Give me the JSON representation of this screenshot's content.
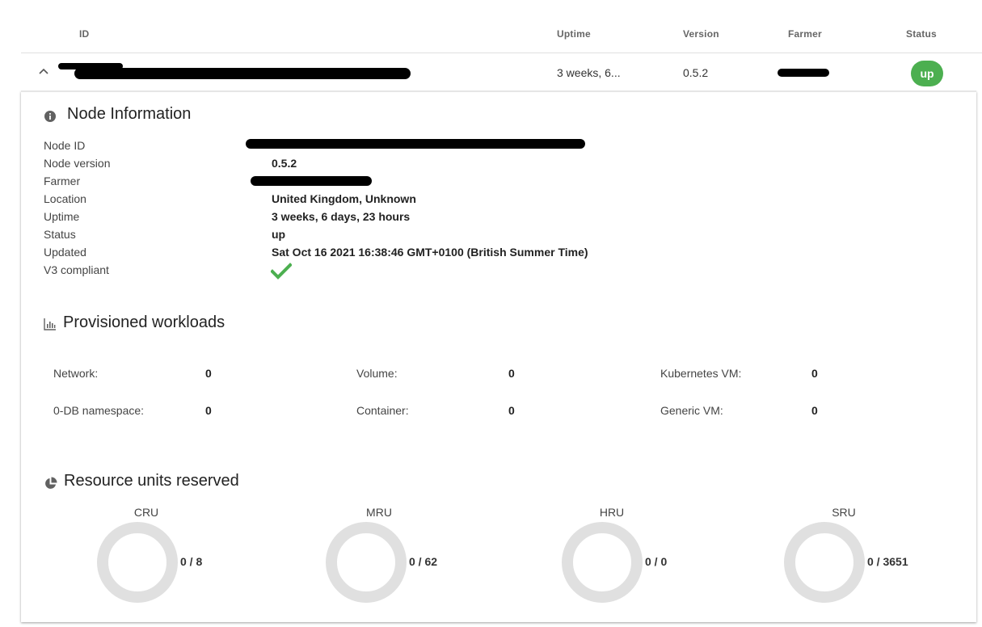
{
  "table": {
    "headers": {
      "id": "ID",
      "uptime": "Uptime",
      "version": "Version",
      "farmer": "Farmer",
      "status": "Status"
    },
    "row": {
      "uptime": "3 weeks, 6...",
      "version": "0.5.2",
      "status": "up"
    }
  },
  "node_info": {
    "title": "Node Information",
    "labels": [
      "Node ID",
      "Node version",
      "Farmer",
      "Location",
      "Uptime",
      "Status",
      "Updated",
      "V3 compliant"
    ],
    "values": {
      "node_version": "0.5.2",
      "location": "United Kingdom, Unknown",
      "uptime": "3 weeks, 6 days, 23 hours",
      "status": "up",
      "updated": "Sat Oct 16 2021 16:38:46 GMT+0100 (British Summer Time)",
      "v3_compliant_icon": "check-icon"
    }
  },
  "workloads": {
    "title": "Provisioned workloads",
    "items": [
      {
        "label": "Network:",
        "value": "0"
      },
      {
        "label": "Volume:",
        "value": "0"
      },
      {
        "label": "Kubernetes VM:",
        "value": "0"
      },
      {
        "label": "0-DB namespace:",
        "value": "0"
      },
      {
        "label": "Container:",
        "value": "0"
      },
      {
        "label": "Generic VM:",
        "value": "0"
      }
    ]
  },
  "resources": {
    "title": "Resource units reserved",
    "units": [
      {
        "label": "CRU",
        "value": "0 / 8",
        "fraction": 0
      },
      {
        "label": "MRU",
        "value": "0 / 62",
        "fraction": 0
      },
      {
        "label": "HRU",
        "value": "0 / 0",
        "fraction": 0
      },
      {
        "label": "SRU",
        "value": "0 / 3651",
        "fraction": 0
      }
    ]
  },
  "colors": {
    "status_up": "#4caf50",
    "check": "#4caf50",
    "donut_track": "#e0e0e0",
    "icon": "#616161"
  }
}
